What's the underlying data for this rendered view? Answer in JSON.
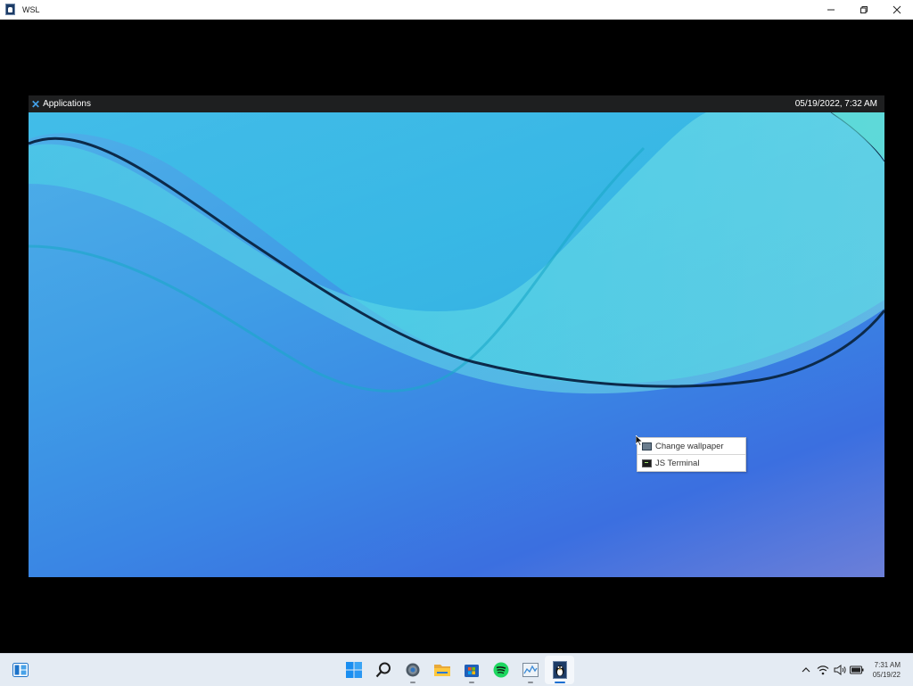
{
  "window": {
    "title": "WSL"
  },
  "panel": {
    "applications_label": "Applications",
    "clock": "05/19/2022, 7:32 AM"
  },
  "context_menu": {
    "items": [
      {
        "label": "Change wallpaper",
        "icon": "wallpaper-icon"
      },
      {
        "label": "JS Terminal",
        "icon": "terminal-icon"
      }
    ]
  },
  "taskbar": {
    "pinned": [
      {
        "name": "start",
        "icon": "windows-start-icon"
      },
      {
        "name": "search",
        "icon": "search-icon"
      },
      {
        "name": "settings",
        "icon": "gear-icon"
      },
      {
        "name": "file-explorer",
        "icon": "folder-icon"
      },
      {
        "name": "microsoft-store",
        "icon": "store-icon"
      },
      {
        "name": "spotify",
        "icon": "spotify-icon"
      },
      {
        "name": "task-manager",
        "icon": "chart-icon"
      },
      {
        "name": "wsl",
        "icon": "tux-icon"
      }
    ],
    "clock": {
      "time": "7:31 AM",
      "date": "05/19/22"
    }
  }
}
